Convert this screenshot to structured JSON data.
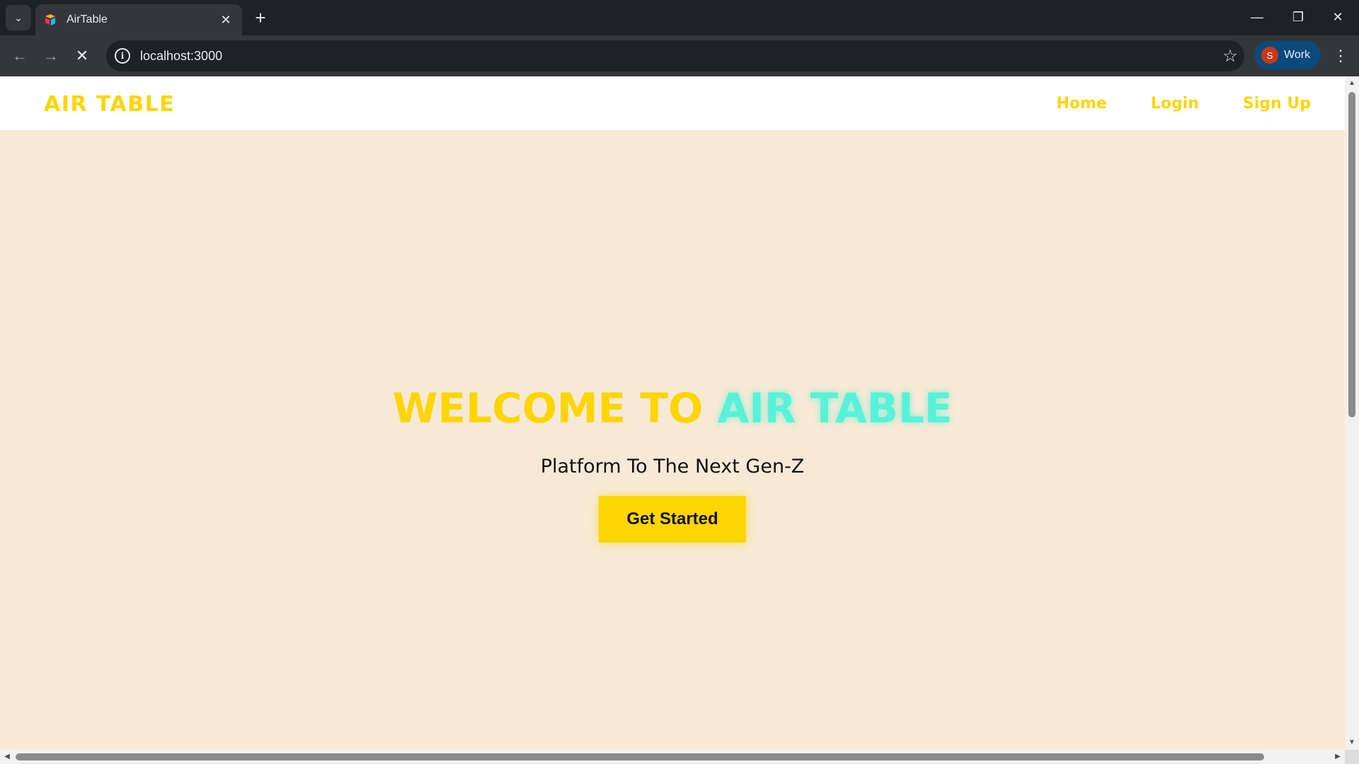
{
  "browser": {
    "tab_title": "AirTable",
    "url": "localhost:3000",
    "profile_initial": "S",
    "profile_label": "Work",
    "colors": {
      "frame": "#202124",
      "toolbar": "#35363a",
      "profile_bg": "#0b4a7c",
      "avatar_bg": "#c43b1b"
    }
  },
  "site": {
    "logo": "AIR TABLE",
    "nav": {
      "home": "Home",
      "login": "Login",
      "signup": "Sign Up"
    },
    "hero": {
      "title_part1": "WELCOME TO ",
      "title_part2": "AIR TABLE",
      "subtitle": "Platform To The Next Gen-Z",
      "cta": "Get Started"
    },
    "colors": {
      "brand_yellow": "#fdd500",
      "accent_cyan": "#58f2d8",
      "background": "#f8e9d6",
      "nav_bg": "#ffffff"
    }
  },
  "icons": [
    "tab-search-icon",
    "favicon-icon",
    "close-icon",
    "plus-icon",
    "minimize-icon",
    "restore-icon",
    "window-close-icon",
    "back-arrow-icon",
    "forward-arrow-icon",
    "stop-loading-icon",
    "site-info-icon",
    "bookmark-star-icon",
    "more-menu-icon"
  ]
}
